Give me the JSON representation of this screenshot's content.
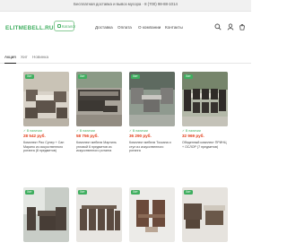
{
  "topbar": {
    "text": "Бесплатная доставка и вывоз мусора · 8 (700) 98-88-1014"
  },
  "header": {
    "logo": "ELITMEBELL.RU",
    "catalog_label": "Каталог",
    "nav": [
      "Доставка",
      "Оплата",
      "О компании",
      "Контакты"
    ],
    "icons": [
      "search-icon",
      "user-icon",
      "cart-icon"
    ]
  },
  "tabs": [
    {
      "label": "Акция",
      "active": true
    },
    {
      "label": "Хит",
      "active": false
    },
    {
      "label": "Новинка",
      "active": false
    }
  ],
  "products": [
    {
      "badge": "Хит",
      "stock": "✓ В наличии",
      "price": "28 542 руб.",
      "name": "Комплект Рио Супер + Сан Марино из искусственного ротанга (8 предметов)"
    },
    {
      "badge": "Хит",
      "stock": "✓ В наличии",
      "price": "58 756 руб.",
      "name": "Комплект мебели Мартиль угловой 6 предметов из искусственного ротанга"
    },
    {
      "badge": "Хит",
      "stock": "✓ В наличии",
      "price": "36 290 руб.",
      "name": "Комплект мебели Тоскана и стул из искусственного ротанга"
    },
    {
      "badge": "Хит",
      "stock": "✓ В наличии",
      "price": "32 969 руб.",
      "name": "Обеденный комплект ПРИНЦ + ОСЛОР (7 предметов)"
    },
    {
      "badge": "Хит",
      "stock": "",
      "price": "",
      "name": ""
    },
    {
      "badge": "Хит",
      "stock": "",
      "price": "",
      "name": ""
    },
    {
      "badge": "Хит",
      "stock": "",
      "price": "",
      "name": ""
    },
    {
      "badge": "Хит",
      "stock": "",
      "price": "",
      "name": ""
    }
  ]
}
